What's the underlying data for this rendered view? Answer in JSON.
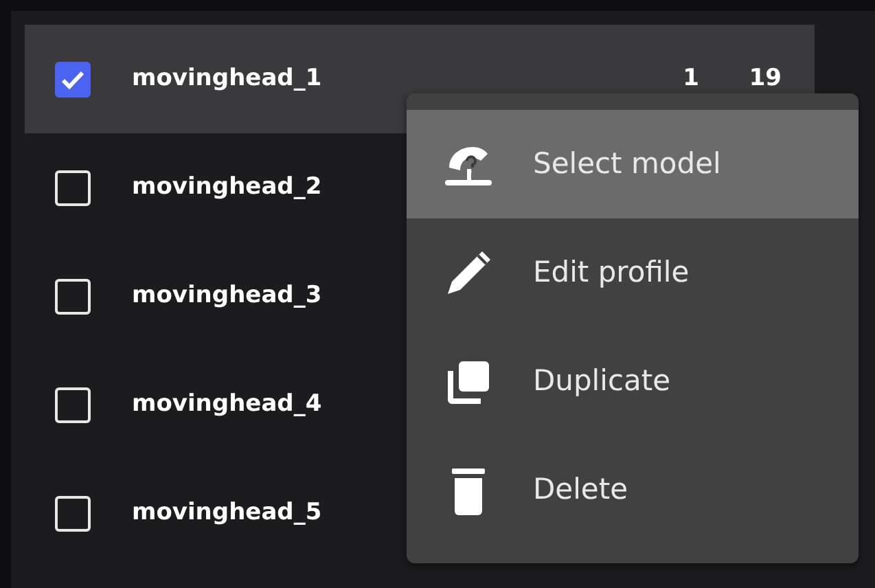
{
  "rows": [
    {
      "name": "movinghead_1",
      "checked": true,
      "selected": true,
      "column_2": "1",
      "column_3": "19"
    },
    {
      "name": "movinghead_2",
      "checked": false,
      "selected": false
    },
    {
      "name": "movinghead_3",
      "checked": false,
      "selected": false
    },
    {
      "name": "movinghead_4",
      "checked": false,
      "selected": false
    },
    {
      "name": "movinghead_5",
      "checked": false,
      "selected": false
    }
  ],
  "context_menu": {
    "items": [
      {
        "kind": "model",
        "label": "Select model",
        "selected": true
      },
      {
        "kind": "edit",
        "label": "Edit profile",
        "selected": false
      },
      {
        "kind": "duplicate",
        "label": "Duplicate",
        "selected": false
      },
      {
        "kind": "delete",
        "label": "Delete",
        "selected": false
      }
    ]
  }
}
